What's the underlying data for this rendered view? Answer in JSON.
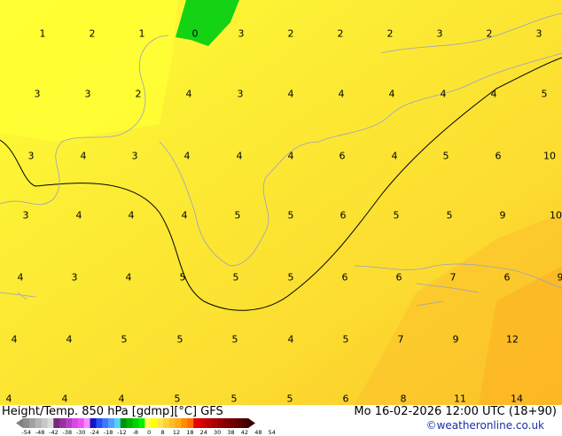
{
  "map": {
    "field_values": [
      [
        "1",
        "2",
        "1",
        "0",
        "3",
        "2",
        "2",
        "2",
        "3",
        "2",
        "3"
      ],
      [
        "3",
        "3",
        "2",
        "4",
        "3",
        "4",
        "4",
        "4",
        "4",
        "4",
        "5"
      ],
      [
        "3",
        "4",
        "3",
        "4",
        "4",
        "4",
        "6",
        "4",
        "5",
        "6",
        "10"
      ],
      [
        "3",
        "4",
        "4",
        "4",
        "5",
        "5",
        "6",
        "5",
        "5",
        "9",
        "10"
      ],
      [
        "4",
        "3",
        "4",
        "5",
        "5",
        "5",
        "6",
        "6",
        "7",
        "6",
        "9"
      ],
      [
        "4",
        "4",
        "5",
        "5",
        "5",
        "4",
        "5",
        "7",
        "9",
        "12"
      ],
      [
        "4",
        "4",
        "4",
        "5",
        "5",
        "5",
        "6",
        "8",
        "11",
        "14"
      ]
    ]
  },
  "footer": {
    "title": "Height/Temp. 850 hPa [gdmp][°C] GFS",
    "datetime": "Mo 16-02-2026 12:00 UTC (18+90)",
    "credit": "©weatheronline.co.uk"
  },
  "legend": {
    "ticks": [
      "-54",
      "-48",
      "-42",
      "-38",
      "-30",
      "-24",
      "-18",
      "-12",
      "-8",
      "0",
      "8",
      "12",
      "18",
      "24",
      "30",
      "38",
      "42",
      "48",
      "54"
    ],
    "colors": [
      "#8c8c8c",
      "#a0a0a0",
      "#b4b4b4",
      "#c8c8c8",
      "#dcdcdc",
      "#782878",
      "#9632a0",
      "#b43cc8",
      "#d746e6",
      "#f050f0",
      "#fa8cfa",
      "#1414c8",
      "#2850f0",
      "#3c78ff",
      "#50a0ff",
      "#50d2ff",
      "#009600",
      "#00b400",
      "#00d200",
      "#00f000",
      "#ffff50",
      "#ffff00",
      "#ffe650",
      "#ffd232",
      "#ffbe28",
      "#ffaa14",
      "#ff8c00",
      "#ff6e00",
      "#e60000",
      "#d20000",
      "#be0000",
      "#aa0000",
      "#960000",
      "#820000",
      "#6e0000",
      "#5a0000",
      "#460000"
    ]
  }
}
